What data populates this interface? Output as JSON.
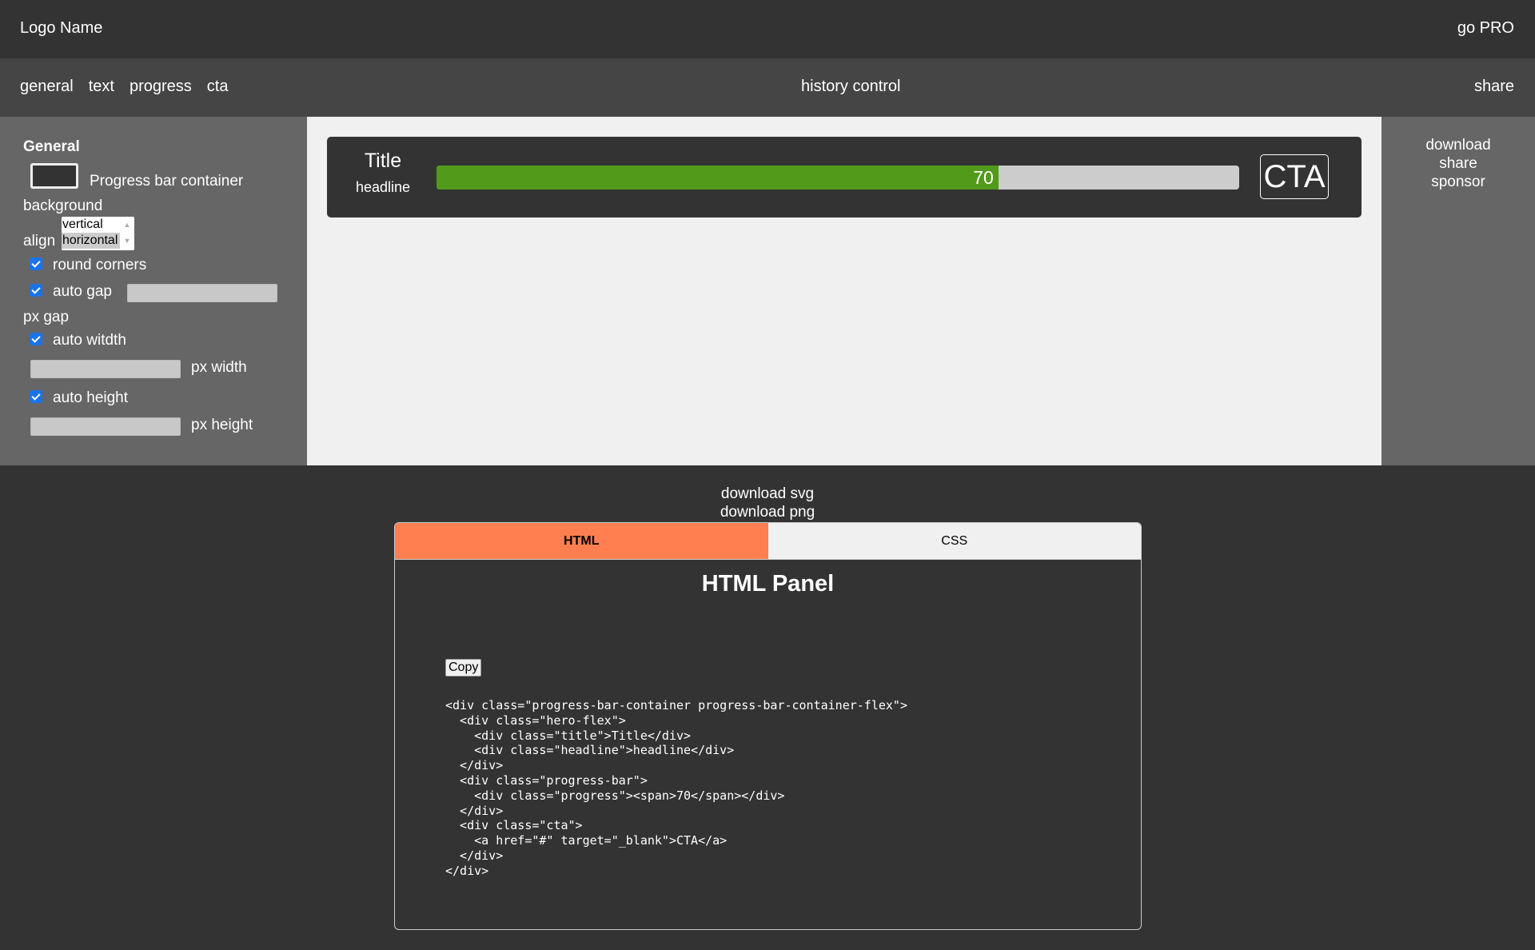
{
  "header": {
    "logo": "Logo Name",
    "go_pro": "go PRO"
  },
  "nav": {
    "tabs": [
      "general",
      "text",
      "progress",
      "cta"
    ],
    "history": "history control",
    "share": "share"
  },
  "sidebar": {
    "heading": "General",
    "container_color": "#333333",
    "container_label": "Progress bar container",
    "background_label": "background",
    "align_label": "align",
    "align_options": [
      "vertical",
      "horizontal"
    ],
    "align_selected": "horizontal",
    "round_corners": {
      "label": "round corners",
      "checked": true
    },
    "auto_gap": {
      "label": "auto gap",
      "checked": true,
      "value": ""
    },
    "px_gap": "px gap",
    "auto_width": {
      "label": "auto witdth",
      "checked": true,
      "value": ""
    },
    "px_width": "px width",
    "auto_height": {
      "label": "auto height",
      "checked": true,
      "value": ""
    },
    "px_height": "px height"
  },
  "preview": {
    "title": "Title",
    "headline": "headline",
    "progress_percent": 70,
    "progress_label": "70",
    "cta": "CTA",
    "colors": {
      "container": "#333333",
      "fill": "#529a1a",
      "track": "#cccccc"
    }
  },
  "right_panel": {
    "items": [
      "download",
      "share",
      "sponsor"
    ]
  },
  "downloads": {
    "svg": "download svg",
    "png": "download png"
  },
  "code_panel": {
    "tabs": [
      {
        "label": "HTML",
        "active": true
      },
      {
        "label": "CSS",
        "active": false
      }
    ],
    "accent": "#ff7f50",
    "title": "HTML Panel",
    "copy_label": "Copy",
    "code_lines": [
      "<div class=\"progress-bar-container progress-bar-container-flex\">",
      "  <div class=\"hero-flex\">",
      "    <div class=\"title\">Title</div>",
      "    <div class=\"headline\">headline</div>",
      "  </div>",
      "  <div class=\"progress-bar\">",
      "    <div class=\"progress\"><span>70</span></div>",
      "  </div>",
      "  <div class=\"cta\">",
      "    <a href=\"#\" target=\"_blank\">CTA</a>",
      "  </div>",
      "</div>"
    ]
  }
}
